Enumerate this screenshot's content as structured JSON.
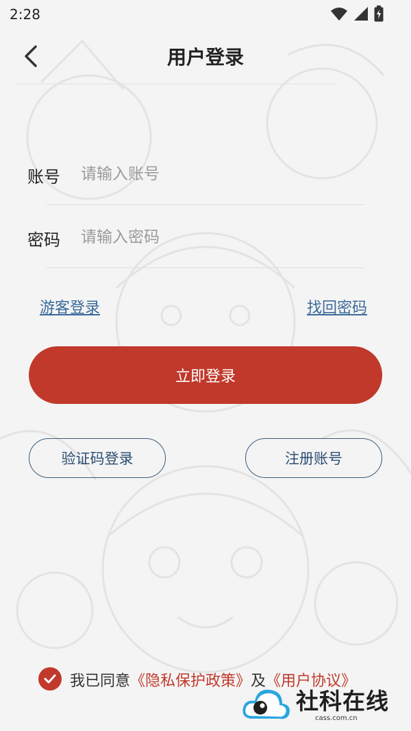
{
  "status": {
    "time": "2:28"
  },
  "nav": {
    "title": "用户登录"
  },
  "form": {
    "account_label": "账号",
    "account_placeholder": "请输入账号",
    "password_label": "密码",
    "password_placeholder": "请输入密码"
  },
  "links": {
    "guest_login": "游客登录",
    "recover_password": "找回密码"
  },
  "buttons": {
    "login": "立即登录",
    "sms_login": "验证码登录",
    "register": "注册账号"
  },
  "agreement": {
    "prefix": "我已同意",
    "privacy_policy": "《隐私保护政策》",
    "and": "及",
    "user_agreement": "《用户协议》"
  },
  "watermark": {
    "name": "社科在线",
    "url": "cass.com.cn"
  },
  "colors": {
    "accent": "#c0392b",
    "link": "#3a6a9a",
    "outline": "#3a5a7a"
  }
}
